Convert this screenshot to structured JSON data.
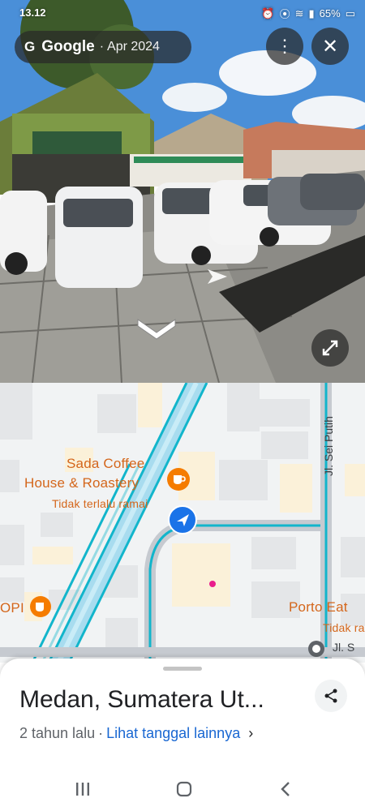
{
  "status_bar": {
    "time": "13.12",
    "battery": "65%"
  },
  "top_bar": {
    "g_icon": "G",
    "brand": "Google",
    "separator": "·",
    "date": "Apr 2024"
  },
  "icons": {
    "more": "more-vert-icon",
    "close": "close-icon",
    "expand": "expand-icon",
    "nav_arrow": "chevron-down-icon",
    "share": "share-icon",
    "location": "navigation-arrow-icon",
    "coffee": "coffee-cup-icon"
  },
  "map": {
    "poi": {
      "name_line1": "Sada Coffee",
      "name_line2": "House & Roastery",
      "status": "Tidak terlalu ramai"
    },
    "poi_left": "OPI",
    "poi_right": {
      "name": "Porto Eat",
      "status": "Tidak ra"
    },
    "street_vertical": "Jl. Sei Putih",
    "street_bottom": "Jl. S"
  },
  "sheet": {
    "title": "Medan, Sumatera Ut...",
    "age": "2 tahun lalu",
    "separator": "·",
    "link": "Lihat tanggal lainnya"
  },
  "colors": {
    "accent_blue": "#1a73e8",
    "poi_orange": "#d4661b",
    "road_teal": "#12b5cb"
  }
}
